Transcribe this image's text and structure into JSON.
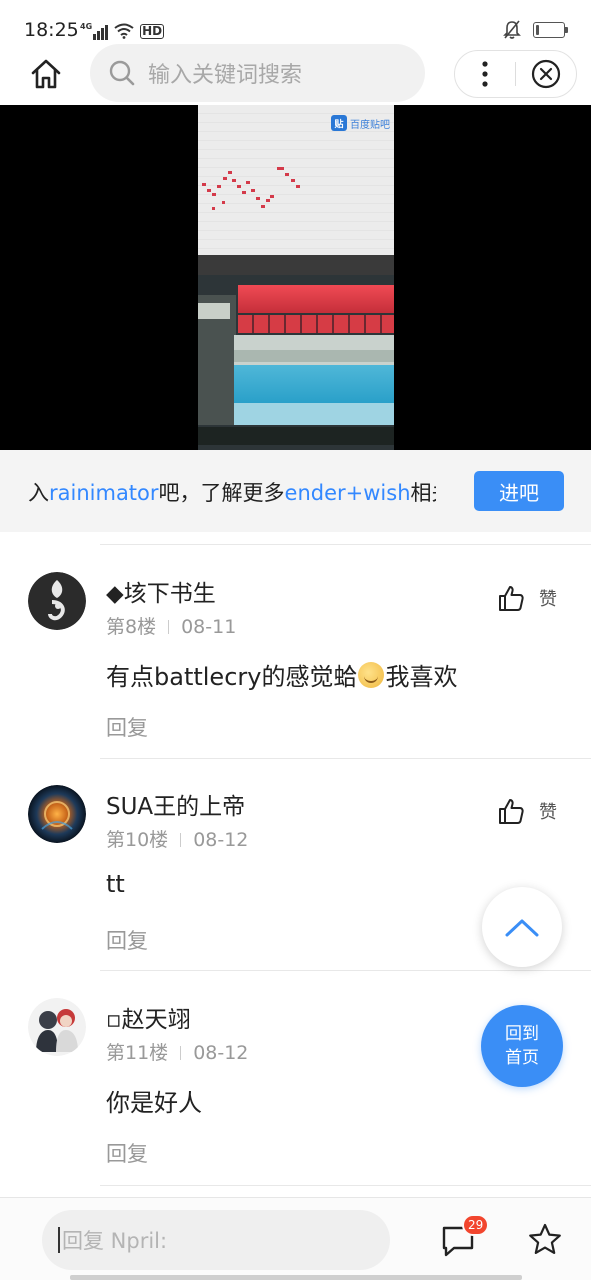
{
  "status_bar": {
    "time": "18:25",
    "network": "4G",
    "hd_label": "HD",
    "battery_level": 0.1
  },
  "nav": {
    "search_placeholder": "输入关键词搜索",
    "home_icon": "home-icon",
    "more_icon": "more-vertical-icon",
    "close_icon": "close-circle-icon"
  },
  "video": {
    "watermark": "百度贴吧",
    "watermark_badge": "贴"
  },
  "banner": {
    "prefix": "入",
    "forum_name": "rainimator",
    "mid": "吧，了解更多",
    "topic": "ender+wish",
    "suffix": "相关",
    "enter_button": "进吧"
  },
  "posts": [
    {
      "username": "◆垓下书生",
      "floor": "第8楼",
      "date": "08-11",
      "content_before": "有点battlecry的感觉蛤",
      "content_after": "我喜欢",
      "like_label": "赞",
      "reply_label": "回复"
    },
    {
      "username": "SUA王的上帝",
      "floor": "第10楼",
      "date": "08-12",
      "content": "tt",
      "like_label": "赞",
      "reply_label": "回复"
    },
    {
      "username": "▫赵天翊",
      "floor": "第11楼",
      "date": "08-12",
      "content": "你是好人",
      "reply_label": "回复"
    }
  ],
  "fab": {
    "home_line1": "回到",
    "home_line2": "首页"
  },
  "bottom_bar": {
    "reply_placeholder": "回复 Npril:",
    "comment_count": "29"
  },
  "colors": {
    "accent": "#3a8ef6",
    "link": "#3388ff",
    "badge": "#f2462e"
  }
}
